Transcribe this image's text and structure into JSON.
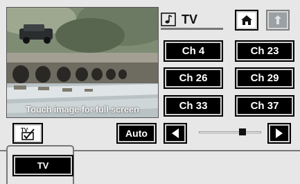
{
  "preview": {
    "caption": "Touch image for full screen"
  },
  "header": {
    "source_title": "TV",
    "source_icon": "music-note-icon",
    "home_icon": "home-icon",
    "back_icon": "return-arrow-icon"
  },
  "channels": [
    {
      "label": "Ch 4"
    },
    {
      "label": "Ch 23"
    },
    {
      "label": "Ch 26"
    },
    {
      "label": "Ch 29"
    },
    {
      "label": "Ch 33"
    },
    {
      "label": "Ch 37"
    }
  ],
  "controls": {
    "tv_select_icon": "tv-checkbox-icon",
    "auto_label": "Auto",
    "prev_icon": "triangle-left-icon",
    "next_icon": "triangle-right-icon",
    "tuning_level": 0.72
  },
  "bottom_tabs": [
    {
      "label": "TV"
    }
  ],
  "colors": {
    "background": "#e7e7e7",
    "button": "#000000",
    "button_text": "#ffffff"
  }
}
